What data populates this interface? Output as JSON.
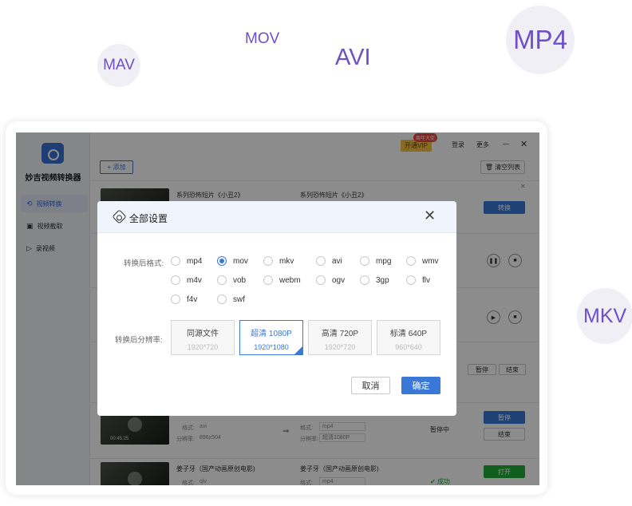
{
  "tags": {
    "mav": "MAV",
    "mov": "MOV",
    "avi": "AVI",
    "mp4": "MP4",
    "mkv": "MKV"
  },
  "app": {
    "name": "妙吉视频转换器"
  },
  "sidebar": {
    "items": [
      {
        "label": "视频转换",
        "icon": "convert-icon"
      },
      {
        "label": "视频截取",
        "icon": "crop-icon"
      },
      {
        "label": "录视频",
        "icon": "record-icon"
      }
    ]
  },
  "topbar": {
    "vip": "开通VIP",
    "vip_badge": "周年大促",
    "login": "登录",
    "more": "更多",
    "minimize": "—",
    "close": "✕"
  },
  "toolbar": {
    "add": "+ 添加",
    "clear": "清空列表"
  },
  "rows": [
    {
      "title": "系列恐怖短片《小丑2》",
      "title2": "系列恐怖短片《小丑2》",
      "action": "转换"
    },
    {
      "format_label": "格式:",
      "format": "avi",
      "res_label": "分辨率:",
      "res": "896x504",
      "out_format": "mp4",
      "out_res": "超清1080P",
      "status": "暂停中",
      "btn1": "暂停",
      "btn2": "结束",
      "duration": "00:45:25"
    },
    {
      "title": "姜子牙（国产动画原创电影)",
      "title2": "姜子牙（国产动画原创电影)",
      "format_label": "格式:",
      "format": "qlv",
      "out_format": "mp4",
      "status": "成功",
      "btn1": "打开"
    }
  ],
  "side_controls": {
    "pause": "暂停",
    "end": "结束"
  },
  "dialog": {
    "title": "全部设置",
    "format_label": "转换后格式:",
    "formats": [
      "mp4",
      "mov",
      "mkv",
      "avi",
      "mpg",
      "wmv",
      "m4v",
      "vob",
      "webm",
      "ogv",
      "3gp",
      "flv",
      "f4v",
      "swf"
    ],
    "selected_format": "mov",
    "res_label": "转换后分辨率:",
    "resolutions": [
      {
        "name": "同源文件",
        "value": "1920*720"
      },
      {
        "name": "超清 1080P",
        "value": "1920*1080"
      },
      {
        "name": "高清 720P",
        "value": "1920*720"
      },
      {
        "name": "标清 640P",
        "value": "960*640"
      }
    ],
    "selected_resolution": "超清 1080P",
    "cancel": "取消",
    "ok": "确定"
  }
}
